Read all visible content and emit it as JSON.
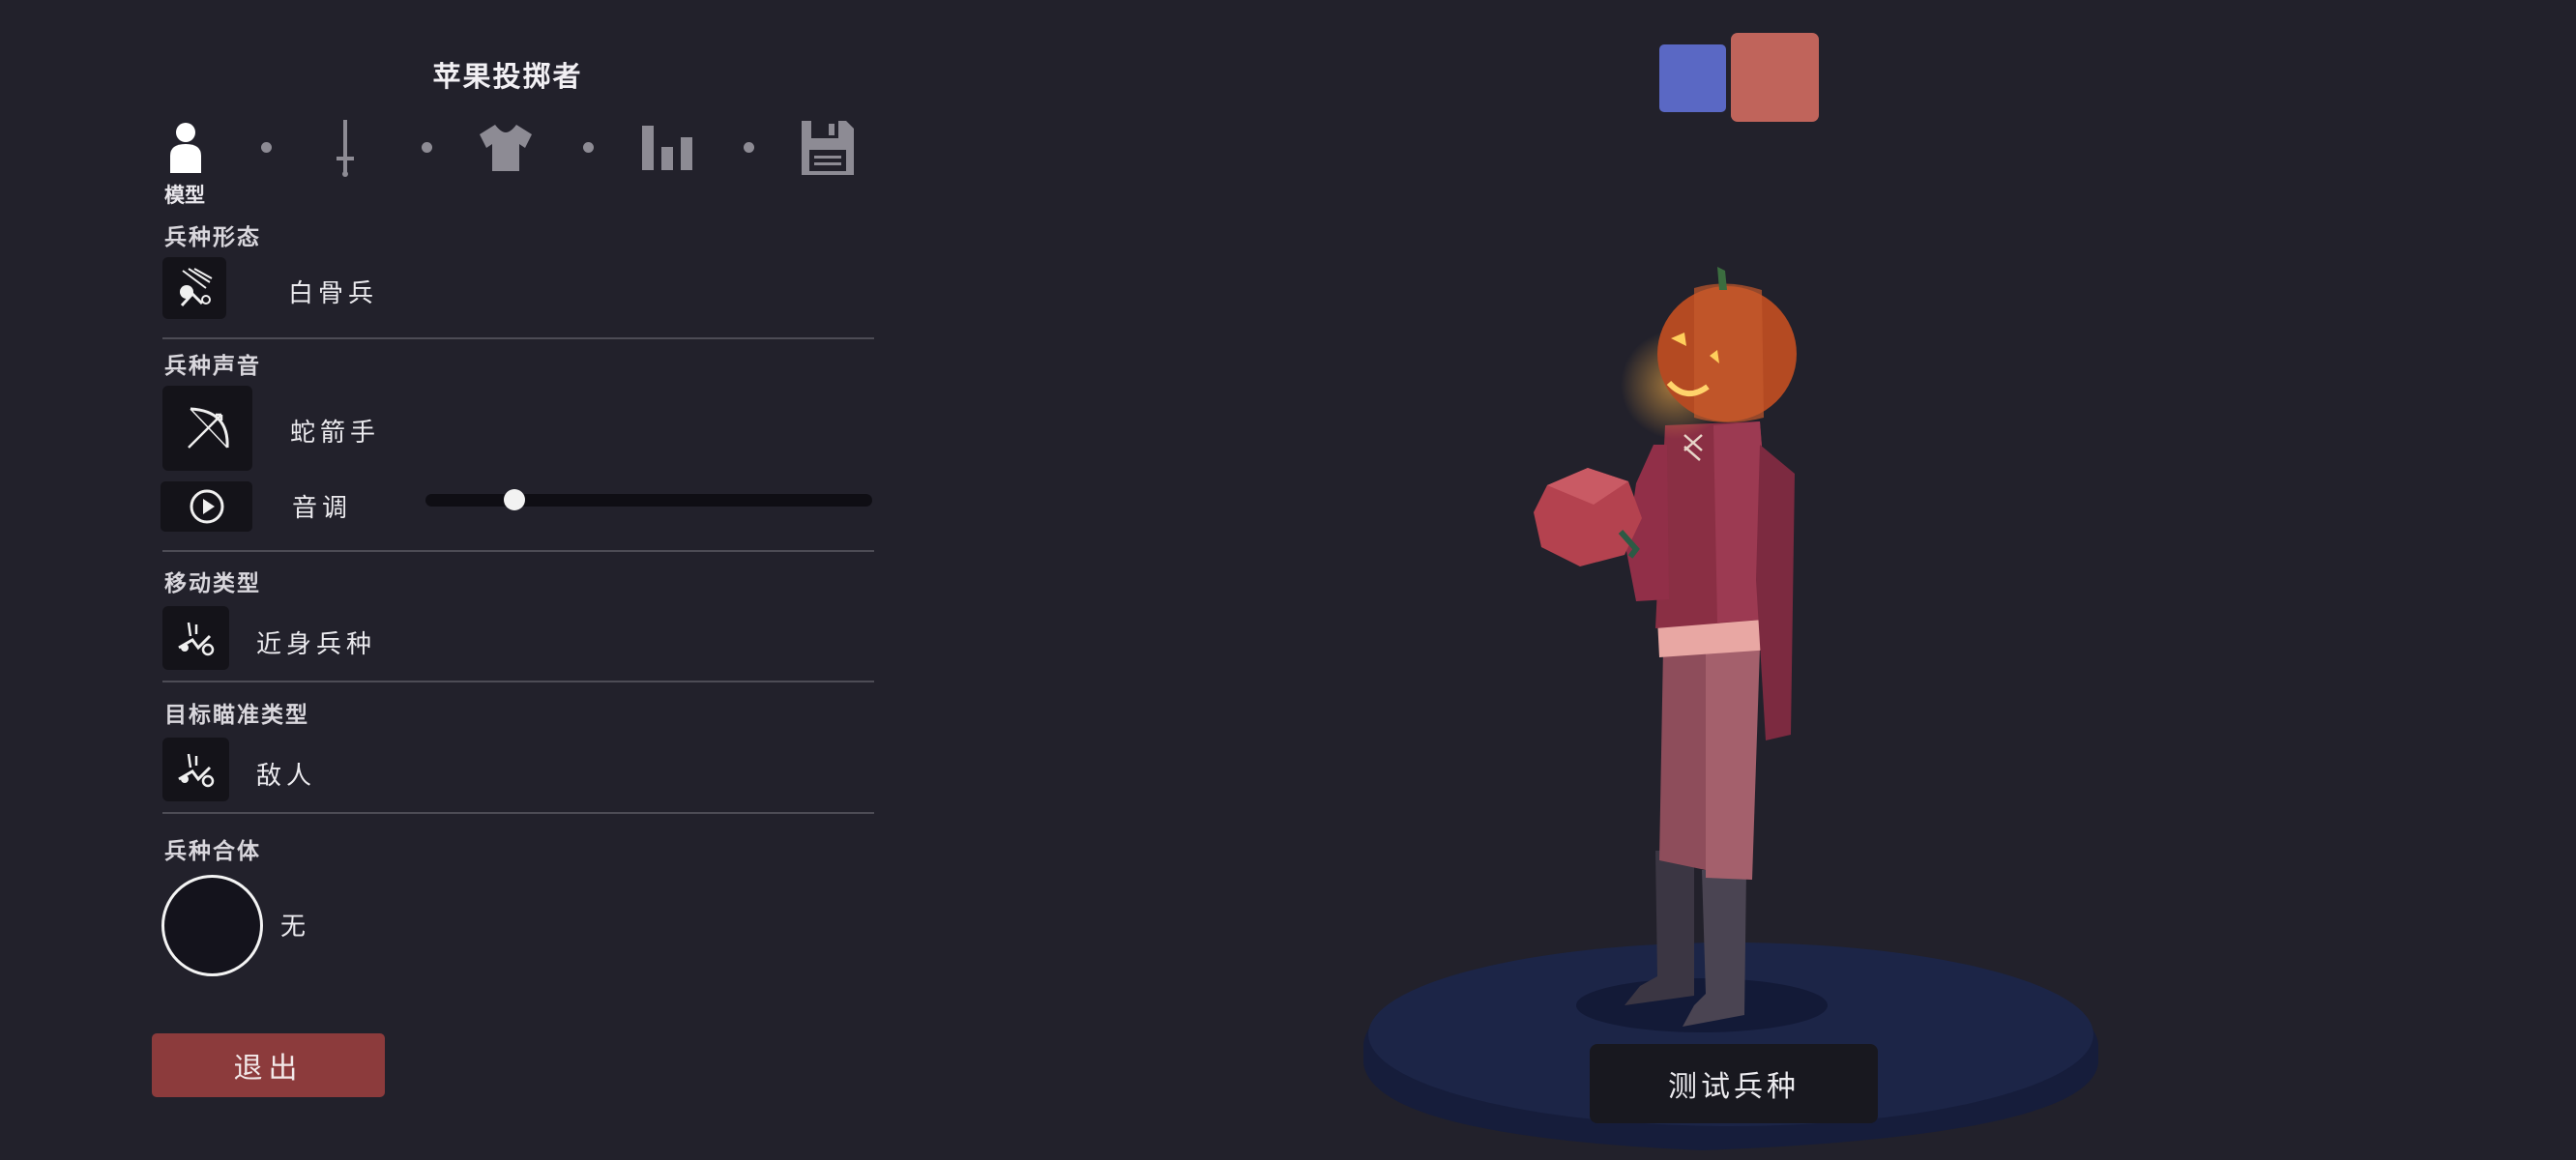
{
  "header": {
    "title": "苹果投掷者"
  },
  "steps": [
    {
      "icon": "person-icon",
      "label": "模型",
      "active": true
    },
    {
      "icon": "sword-icon",
      "active": false
    },
    {
      "icon": "shirt-icon",
      "active": false
    },
    {
      "icon": "bar-chart-icon",
      "active": false
    },
    {
      "icon": "floppy-disk-icon",
      "active": false
    }
  ],
  "sections": {
    "form": {
      "label": "兵种形态",
      "value": "白骨兵",
      "icon": "skeleton-icon"
    },
    "voice": {
      "label": "兵种声音",
      "value": "蛇箭手",
      "icon": "bow-icon",
      "pitch_label": "音调",
      "pitch_level": 0.2
    },
    "movement": {
      "label": "移动类型",
      "value": "近身兵种",
      "icon": "melee-icon"
    },
    "target": {
      "label": "目标瞄准类型",
      "value": "敌人",
      "icon": "melee-icon"
    },
    "combine": {
      "label": "兵种合体",
      "value": "无"
    }
  },
  "footer": {
    "exit_label": "退出"
  },
  "team_swatches": [
    {
      "color": "#5a68c4",
      "selected": false
    },
    {
      "color": "#c0645b",
      "selected": true
    }
  ],
  "test_unit_label": "测试兵种"
}
